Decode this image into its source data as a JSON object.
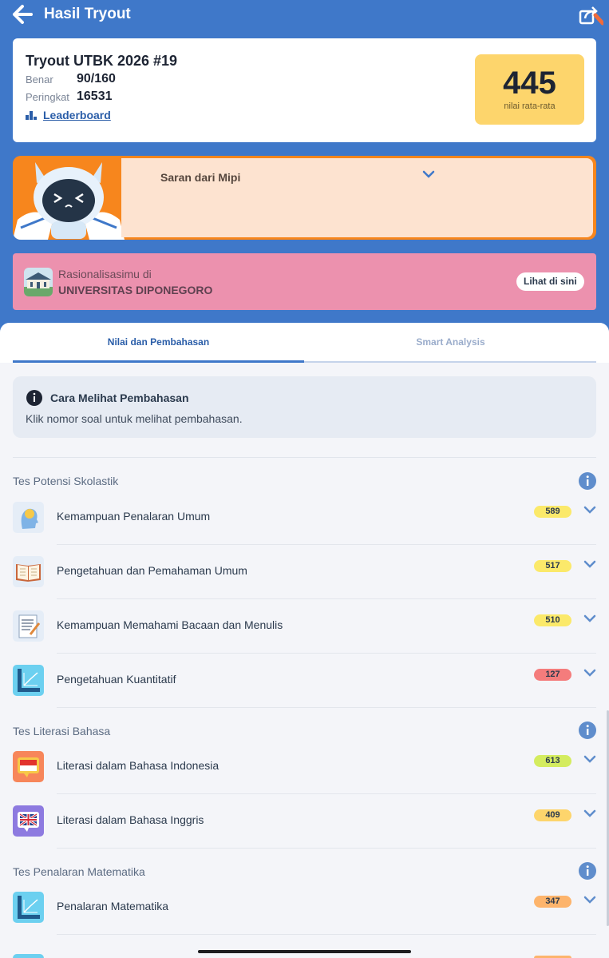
{
  "header": {
    "title": "Hasil Tryout",
    "back_icon": "back-arrow-icon",
    "share_icon": "share-icon"
  },
  "summary": {
    "title": "Tryout UTBK 2026 #19",
    "benar_label": "Benar",
    "benar_value": "90/160",
    "peringkat_label": "Peringkat",
    "peringkat_value": "16531",
    "leaderboard_label": "Leaderboard",
    "score": "445",
    "score_caption": "nilai rata-rata"
  },
  "mipi": {
    "title": "Saran dari Mipi"
  },
  "rasionalisasi": {
    "small": "Rasionalisasimu di",
    "university": "UNIVERSITAS DIPONEGORO",
    "button": "Lihat di sini"
  },
  "tabs": {
    "active": "Nilai dan Pembahasan",
    "inactive": "Smart Analysis"
  },
  "info": {
    "title": "Cara Melihat Pembahasan",
    "text": "Klik nomor soal untuk melihat pembahasan."
  },
  "sections": {
    "tps": "Tes Potensi Skolastik",
    "literasi": "Tes Literasi Bahasa",
    "matematika": "Tes Penalaran Matematika"
  },
  "subtests": [
    {
      "label": "Kemampuan Penalaran Umum",
      "score": "589",
      "color": "#fbe96a",
      "icon": "brain-head-icon"
    },
    {
      "label": "Pengetahuan dan Pemahaman Umum",
      "score": "517",
      "color": "#fbe96a",
      "icon": "open-book-icon"
    },
    {
      "label": "Kemampuan Memahami Bacaan dan Menulis",
      "score": "510",
      "color": "#fbe96a",
      "icon": "writing-paper-icon"
    },
    {
      "label": "Pengetahuan Kuantitatif",
      "score": "127",
      "color": "#f47c7c",
      "icon": "ruler-graph-icon"
    },
    {
      "label": "Literasi dalam Bahasa Indonesia",
      "score": "613",
      "color": "#d4ec5f",
      "icon": "indonesia-flag-chat-icon"
    },
    {
      "label": "Literasi dalam Bahasa Inggris",
      "score": "409",
      "color": "#fdd56c",
      "icon": "uk-flag-chat-icon"
    },
    {
      "label": "Penalaran Matematika",
      "score": "347",
      "color": "#fdb46c",
      "icon": "ruler-graph-icon"
    }
  ]
}
